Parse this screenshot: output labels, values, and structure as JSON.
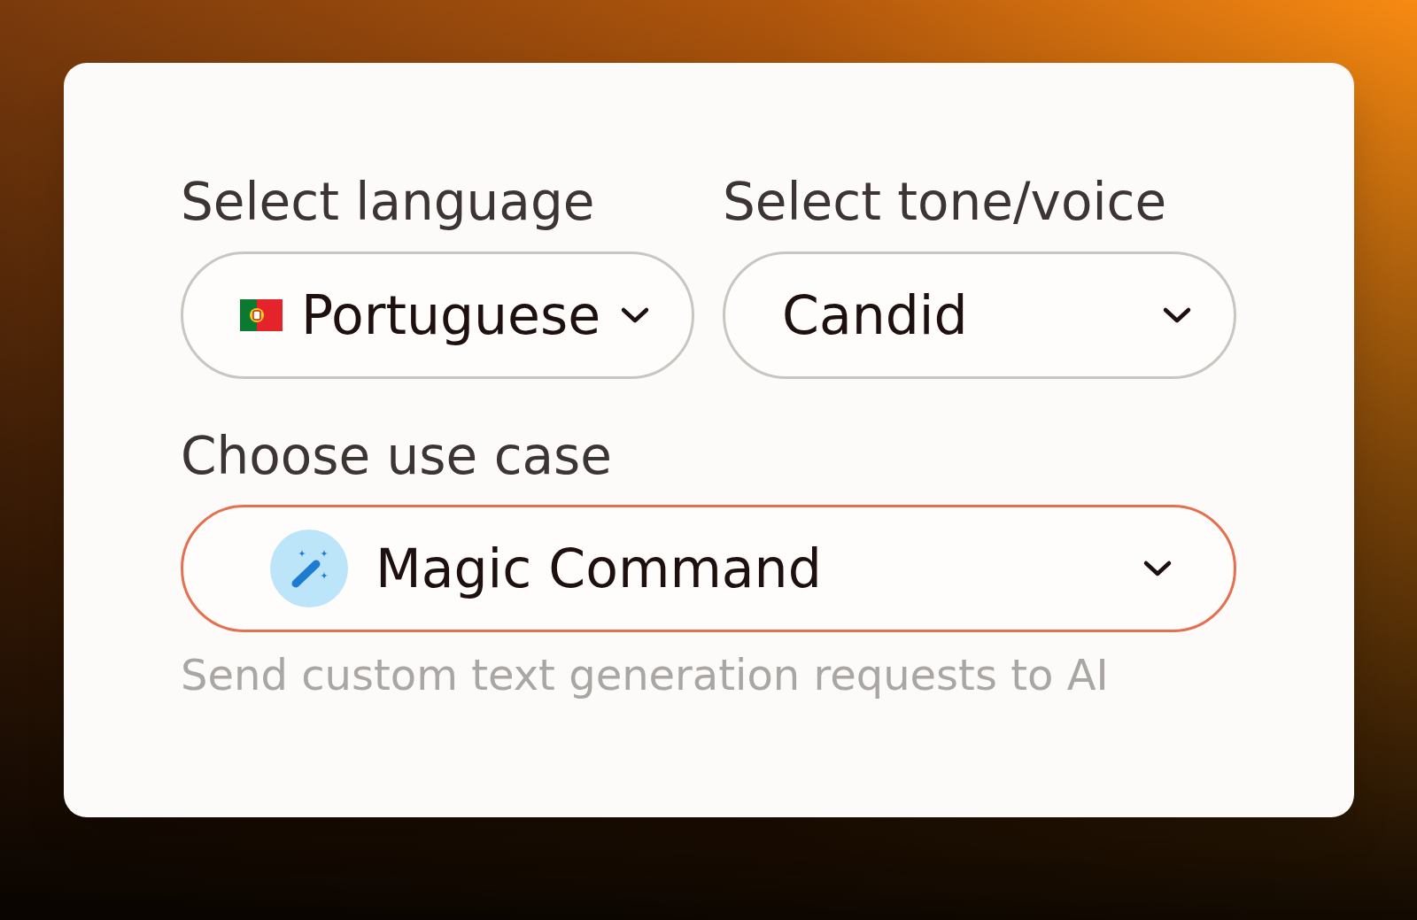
{
  "fields": [
    {
      "kind": "language",
      "label": "Select language",
      "value": "Portuguese",
      "focused": false
    },
    {
      "kind": "tone",
      "label": "Select tone/voice",
      "value": "Candid",
      "focused": false
    },
    {
      "kind": "use_case",
      "label": "Choose use case",
      "value": "Magic Command",
      "focused": true,
      "description": "Send custom text generation requests to AI"
    }
  ]
}
